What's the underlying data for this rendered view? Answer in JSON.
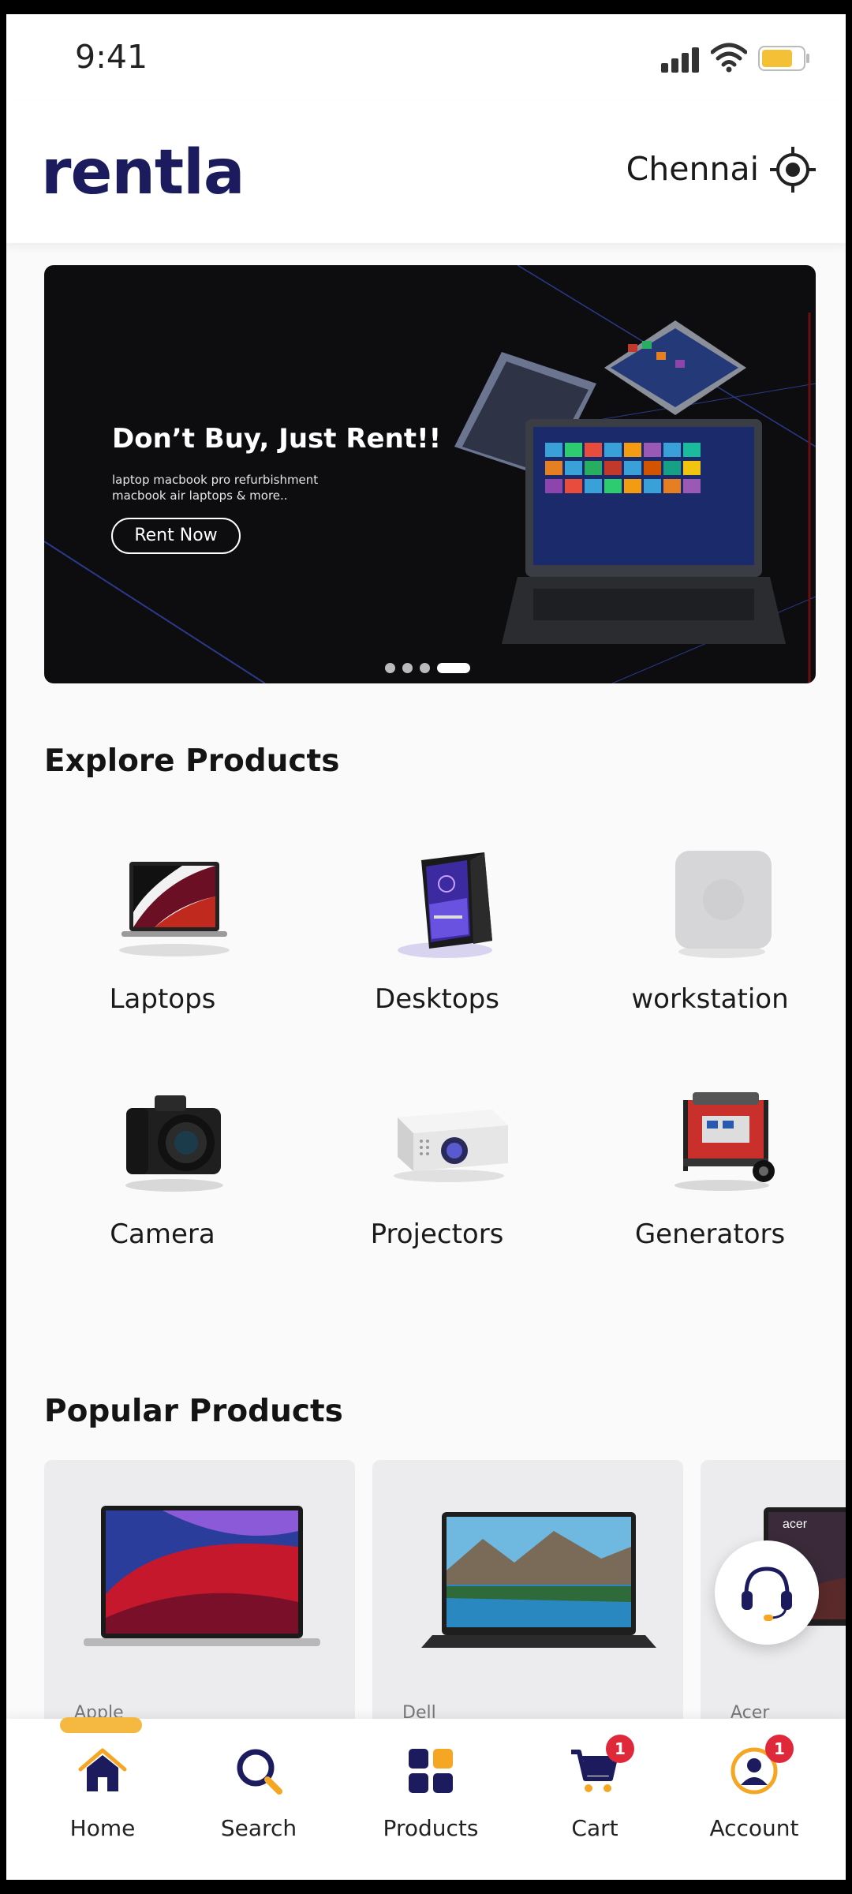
{
  "status_bar": {
    "time": "9:41"
  },
  "header": {
    "brand": "rentla",
    "location": "Chennai"
  },
  "banner": {
    "title": "Don’t Buy, Just Rent!!",
    "subtitle": "laptop macbook pro  refurbishment macbook air laptops & more..",
    "cta": "Rent Now",
    "dots_count": 4,
    "active_dot": 4
  },
  "explore": {
    "title": "Explore Products",
    "categories": [
      {
        "label": "Laptops",
        "icon": "laptop-icon"
      },
      {
        "label": "Desktops",
        "icon": "desktop-icon"
      },
      {
        "label": "workstation",
        "icon": "workstation-icon"
      },
      {
        "label": "Camera",
        "icon": "camera-icon"
      },
      {
        "label": "Projectors",
        "icon": "projector-icon"
      },
      {
        "label": "Generators",
        "icon": "generator-icon"
      }
    ]
  },
  "popular": {
    "title": "Popular Products",
    "products": [
      {
        "brand": "Apple"
      },
      {
        "brand": "Dell"
      },
      {
        "brand": "Acer"
      }
    ]
  },
  "nav": {
    "items": [
      {
        "label": "Home",
        "icon": "home-icon"
      },
      {
        "label": "Search",
        "icon": "search-icon"
      },
      {
        "label": "Products",
        "icon": "grid-icon"
      },
      {
        "label": "Cart",
        "icon": "cart-icon",
        "badge": "1"
      },
      {
        "label": "Account",
        "icon": "account-icon",
        "badge": "1"
      }
    ]
  },
  "colors": {
    "navy": "#1b1b5e",
    "accent": "#f5a623",
    "badge": "#e0283b"
  }
}
